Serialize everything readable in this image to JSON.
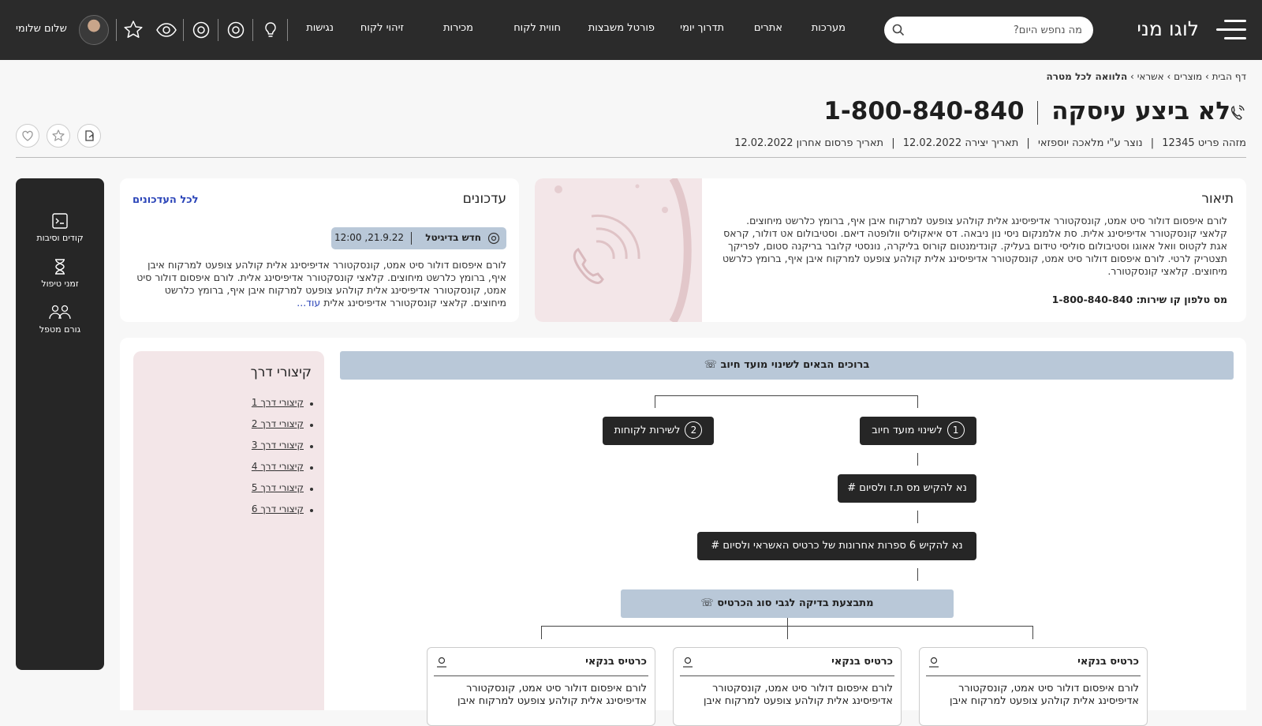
{
  "brand": {
    "logo_text": "לוגו מני"
  },
  "search": {
    "placeholder": "מה נחפש היום?"
  },
  "nav": [
    "מערכות",
    "אתרים",
    "תדרוך יומי",
    "פורטל משבצות",
    "חווית לקוח",
    "מכירות",
    "זיהוי לקוח",
    "נגישות"
  ],
  "user": {
    "greeting": "שלום שלומי"
  },
  "breadcrumb": {
    "home": "דף הבית",
    "products": "מוצרים",
    "credit": "אשראי",
    "current": "הלוואה לכל מטרה"
  },
  "title": {
    "name": "לא ביצע עיסקה",
    "phone": "1-800-840-840"
  },
  "meta": {
    "id_label": "מזהה פריט",
    "id_value": "12345",
    "creator_label": "נוצר ע\"י",
    "creator_value": "מלאכה יוספזאי",
    "created_label": "תאריך יצירה",
    "created_value": "12.02.2022",
    "published_label": "תאריך פרסום אחרון",
    "published_value": "12.02.2022"
  },
  "description": {
    "title": "תיאור",
    "body": "לורם איפסום דולור סיט אמט, קונסקטורר אדיפיסינג אלית קולהע צופעט למרקוח איבן איף, ברומץ כלרשט מיחוצים. קלאצי קונסקטורר אדיפיסינג אלית. סת אלמנקום ניסי נון ניבאה. דס איאקוליס וולופטה דיאם. וסטיבולום אט דולור, קראס אגת לקטוס וואל אאוגו וסטיבולום סוליסי טידום בעליק. קונדימנטום קורוס בליקרה, נונסטי קלובר בריקנה סטום, לפריקך תצטריק לרטי. לורם איפסום דולור סיט אמט, קונסקטורר אדיפיסינג אלית קולהע צופעט למרקוח איבן איף, ברומץ כלרשט מיחוצים. קלאצי קונסקטורר.",
    "phone_line": "מס טלפון קו שירות: 1-800-840-840"
  },
  "updates": {
    "title": "עדכונים",
    "all_link": "לכל העדכונים",
    "badge_title": "חדש בדיגיטל",
    "badge_time": "21.9.22, 12:00",
    "body": "לורם איפסום דולור סיט אמט, קונסקטורר אדיפיסינג אלית קולהע צופעט למרקוח איבן איף, ברומץ כלרשט מיחוצים. קלאצי קונסקטורר אדיפיסינג אלית. לורם איפסום דולור סיט אמט, קונסקטורר אדיפיסינג אלית קולהע צופעט למרקוח איבן איף, ברומץ כלרשט מיחוצים. קלאצי קונסקטורר אדיפיסינג אלית",
    "more": "עוד..."
  },
  "sidebar": [
    {
      "label": "קודים וסיבות",
      "icon": "terminal-icon"
    },
    {
      "label": "זמני טיפול",
      "icon": "hourglass-icon"
    },
    {
      "label": "גורם מטפל",
      "icon": "team-icon"
    }
  ],
  "shortcuts": {
    "title": "קיצורי דרך",
    "items": [
      "קיצורי דרך 1",
      "קיצורי דרך 2",
      "קיצורי דרך 3",
      "קיצורי דרך 4",
      "קיצורי דרך 5",
      "קיצורי דרך 6"
    ]
  },
  "flow": {
    "header": "ברוכים הבאים לשינוי מועד חיוב",
    "opt1_num": "1",
    "opt1": "לשינוי מועד חיוב",
    "opt2_num": "2",
    "opt2": "לשירות לקוחות",
    "step1": "נא להקיש מס ת.ז ולסיום #",
    "step2": "נא להקיש 6 ספרות אחרונות של כרטיס האשראי ולסיום #",
    "check": "מתבצעת בדיקה לגבי סוג הכרטיס",
    "cards": [
      {
        "title": "כרטיס בנקאי",
        "body": "לורם איפסום דולור סיט אמט, קונסקטורר אדיפיסינג אלית קולהע צופעט למרקוח איבן"
      },
      {
        "title": "כרטיס בנקאי",
        "body": "לורם איפסום דולור סיט אמט, קונסקטורר אדיפיסינג אלית קולהע צופעט למרקוח איבן"
      },
      {
        "title": "כרטיס בנקאי",
        "body": "לורם איפסום דולור סיט אמט, קונסקטורר אדיפיסינג אלית קולהע צופעט למרקוח איבן"
      }
    ]
  }
}
